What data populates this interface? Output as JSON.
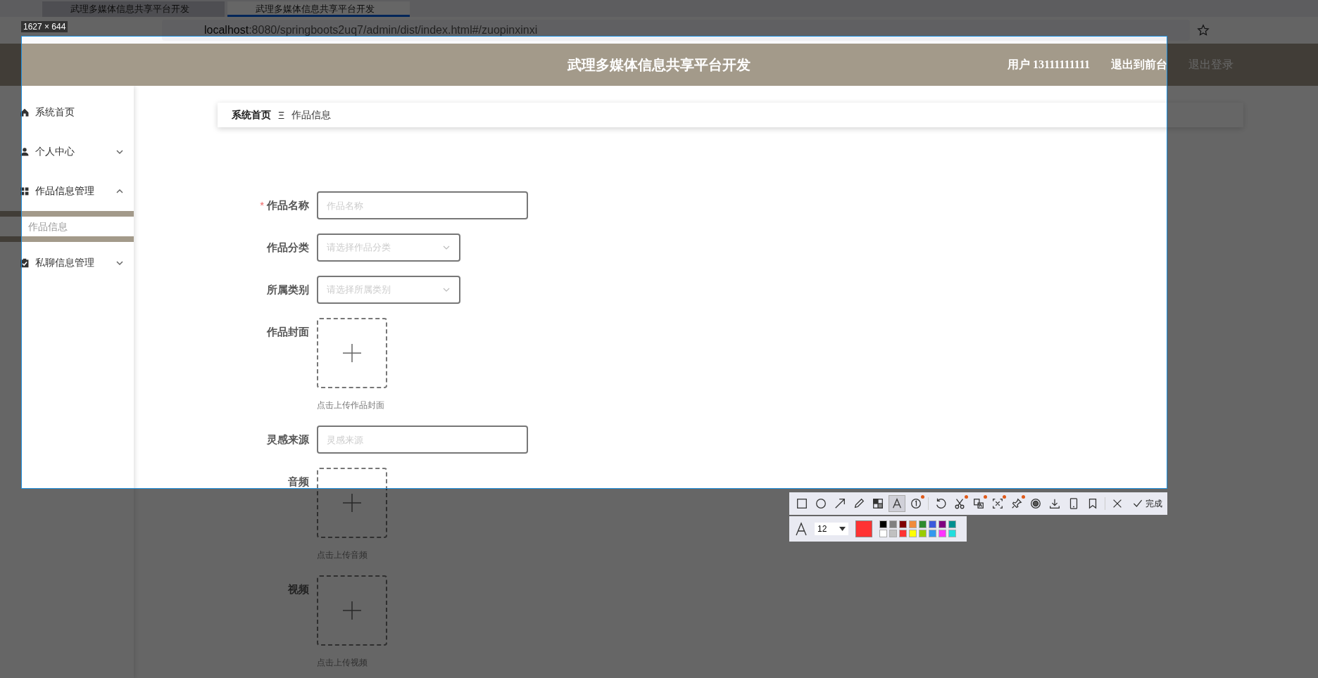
{
  "browser": {
    "tabs": [
      {
        "title": "武理多媒体信息共享平台开发",
        "selected": false
      },
      {
        "title": "武理多媒体信息共享平台开发",
        "selected": true
      }
    ],
    "url": {
      "host": "localhost",
      "rest": ":8080/springboots2uq7/admin/dist/index.html#/zuopinxinxi"
    }
  },
  "header": {
    "title": "武理多媒体信息共享平台开发",
    "user": "用户 13111111111",
    "links": [
      {
        "label": "退出到前台",
        "muted": false
      },
      {
        "label": "退出登录",
        "muted": true
      }
    ]
  },
  "sidebar": {
    "items": [
      {
        "label": "系统首页"
      },
      {
        "label": "个人中心",
        "expanded": false
      },
      {
        "label": "作品信息管理",
        "expanded": true,
        "children": [
          {
            "label": "作品信息",
            "selected": true
          }
        ]
      },
      {
        "label": "私聊信息管理",
        "expanded": false
      }
    ]
  },
  "breadcrumb": [
    "系统首页",
    "作品信息"
  ],
  "breadcrumb_separator": "Ξ",
  "form": {
    "required_mark": "*",
    "fields": [
      {
        "kind": "input",
        "label": "作品名称",
        "required": true,
        "placeholder": "作品名称"
      },
      {
        "kind": "select",
        "label": "作品分类",
        "required": false,
        "placeholder": "请选择作品分类"
      },
      {
        "kind": "select",
        "label": "所属类别",
        "required": false,
        "placeholder": "请选择所属类别"
      },
      {
        "kind": "upload",
        "label": "作品封面",
        "required": false,
        "hint": "点击上传作品封面"
      },
      {
        "kind": "input",
        "label": "灵感来源",
        "required": false,
        "placeholder": "灵感来源"
      },
      {
        "kind": "upload",
        "label": "音频",
        "required": false,
        "hint": "点击上传音频"
      },
      {
        "kind": "upload",
        "label": "视频",
        "required": false,
        "hint": "点击上传视频"
      }
    ]
  },
  "capture": {
    "size_label": "1627 × 644",
    "tool_groups": [
      [
        {
          "kind": "rectangle",
          "selected": false,
          "badge": false
        },
        {
          "kind": "ellipse",
          "selected": false,
          "badge": false
        },
        {
          "kind": "arrow",
          "selected": false,
          "badge": false
        },
        {
          "kind": "pen",
          "selected": false,
          "badge": false
        },
        {
          "kind": "mosaic",
          "selected": false,
          "badge": false
        },
        {
          "kind": "text",
          "selected": true,
          "badge": false
        },
        {
          "kind": "number",
          "selected": false,
          "badge": true
        }
      ],
      [
        {
          "kind": "undo",
          "selected": false,
          "badge": false
        },
        {
          "kind": "scissors",
          "selected": false,
          "badge": true
        },
        {
          "kind": "translate",
          "selected": false,
          "badge": true
        },
        {
          "kind": "ocr",
          "selected": false,
          "badge": true
        },
        {
          "kind": "pin",
          "selected": false,
          "badge": true
        },
        {
          "kind": "record",
          "selected": false,
          "badge": false
        },
        {
          "kind": "download",
          "selected": false,
          "badge": false
        },
        {
          "kind": "phone",
          "selected": false,
          "badge": false
        },
        {
          "kind": "bookmark",
          "selected": false,
          "badge": false
        }
      ],
      [
        {
          "kind": "close",
          "selected": false,
          "badge": false
        }
      ]
    ],
    "done_label": "完成",
    "font_size": "12",
    "swatch": {
      "color": "#ff3333"
    },
    "palette": [
      {
        "color": "#000000"
      },
      {
        "color": "#808080"
      },
      {
        "color": "#800000"
      },
      {
        "color": "#f08c3c"
      },
      {
        "color": "#2e8b2e"
      },
      {
        "color": "#3c5adc"
      },
      {
        "color": "#800080"
      },
      {
        "color": "#009090"
      },
      {
        "color": "#ffffff"
      },
      {
        "color": "#c0c0c0"
      },
      {
        "color": "#ff3333"
      },
      {
        "color": "#ffff00"
      },
      {
        "color": "#99cc00"
      },
      {
        "color": "#3399ee"
      },
      {
        "color": "#ff33ff"
      },
      {
        "color": "#22dddd"
      }
    ]
  }
}
